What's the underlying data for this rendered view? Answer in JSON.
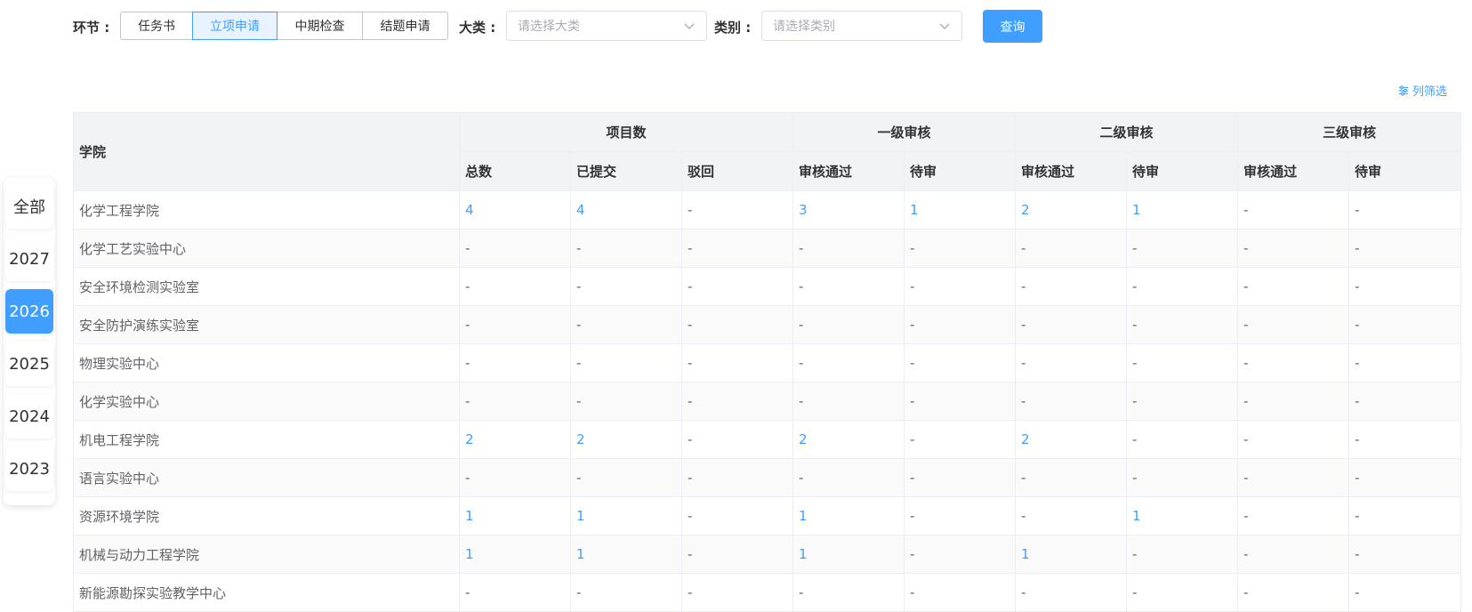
{
  "filters": {
    "stage_label": "环节 :",
    "stages": [
      "任务书",
      "立项申请",
      "中期检查",
      "结题申请"
    ],
    "active_stage": 1,
    "category_label": "大类 :",
    "category_placeholder": "请选择大类",
    "type_label": "类别 :",
    "type_placeholder": "请选择类别",
    "query_label": "查询"
  },
  "column_filter_label": "列筛选",
  "years": [
    "全部",
    "2027",
    "2026",
    "2025",
    "2024",
    "2023"
  ],
  "active_year": 2,
  "table": {
    "college_header": "学院",
    "groups": [
      "项目数",
      "一级审核",
      "二级审核",
      "三级审核"
    ],
    "subheaders": [
      "总数",
      "已提交",
      "驳回",
      "审核通过",
      "待审",
      "审核通过",
      "待审",
      "审核通过",
      "待审"
    ],
    "rows": [
      [
        "化学工程学院",
        "4",
        "4",
        "-",
        "3",
        "1",
        "2",
        "1",
        "-",
        "-"
      ],
      [
        "化学工艺实验中心",
        "-",
        "-",
        "-",
        "-",
        "-",
        "-",
        "-",
        "-",
        "-"
      ],
      [
        "安全环境检测实验室",
        "-",
        "-",
        "-",
        "-",
        "-",
        "-",
        "-",
        "-",
        "-"
      ],
      [
        "安全防护演练实验室",
        "-",
        "-",
        "-",
        "-",
        "-",
        "-",
        "-",
        "-",
        "-"
      ],
      [
        "物理实验中心",
        "-",
        "-",
        "-",
        "-",
        "-",
        "-",
        "-",
        "-",
        "-"
      ],
      [
        "化学实验中心",
        "-",
        "-",
        "-",
        "-",
        "-",
        "-",
        "-",
        "-",
        "-"
      ],
      [
        "机电工程学院",
        "2",
        "2",
        "-",
        "2",
        "-",
        "2",
        "-",
        "-",
        "-"
      ],
      [
        "语言实验中心",
        "-",
        "-",
        "-",
        "-",
        "-",
        "-",
        "-",
        "-",
        "-"
      ],
      [
        "资源环境学院",
        "1",
        "1",
        "-",
        "1",
        "-",
        "-",
        "1",
        "-",
        "-"
      ],
      [
        "机械与动力工程学院",
        "1",
        "1",
        "-",
        "1",
        "-",
        "1",
        "-",
        "-",
        "-"
      ],
      [
        "新能源勘探实验教学中心",
        "-",
        "-",
        "-",
        "-",
        "-",
        "-",
        "-",
        "-",
        "-"
      ]
    ]
  },
  "colors": {
    "primary": "#409eff",
    "header_bg": "#f2f3f5",
    "border": "#ebeef5"
  }
}
